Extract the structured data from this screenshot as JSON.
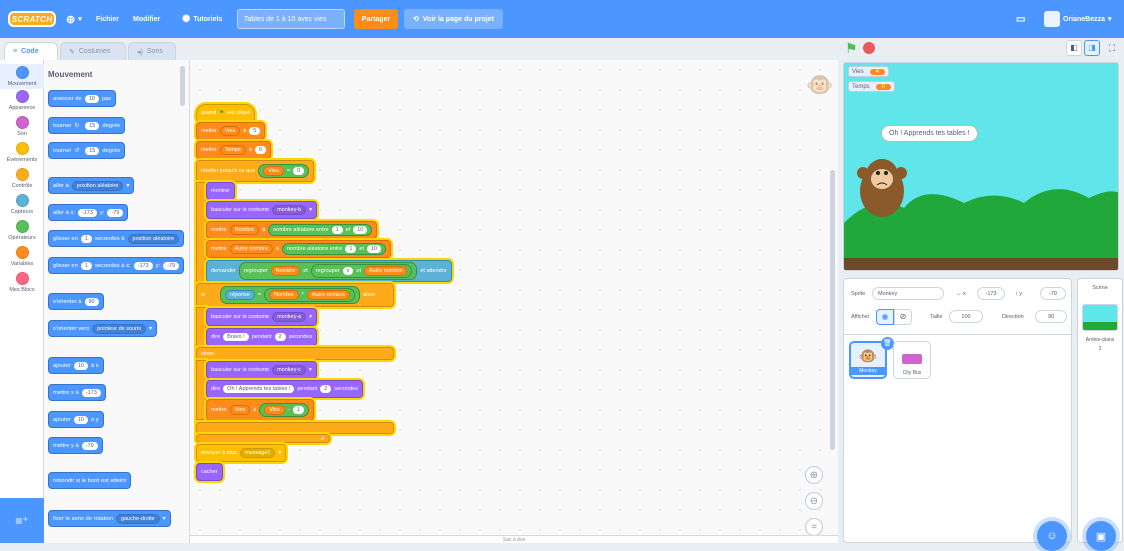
{
  "menubar": {
    "logo": "SCRATCH",
    "file": "Fichier",
    "edit": "Modifier",
    "tutorials": "Tutoriels",
    "project_title": "Tables de 1 à 10 avec vies",
    "share": "Partager",
    "project_page": "Voir la page du projet",
    "username": "OrianeBezza"
  },
  "tabs": {
    "code": "Code",
    "costumes": "Costumes",
    "sounds": "Sons"
  },
  "categories": [
    {
      "label": "Mouvement",
      "color": "#4c97ff"
    },
    {
      "label": "Apparence",
      "color": "#9966ff"
    },
    {
      "label": "Son",
      "color": "#cf63cf"
    },
    {
      "label": "Événements",
      "color": "#ffbf00"
    },
    {
      "label": "Contrôle",
      "color": "#ffab19"
    },
    {
      "label": "Capteurs",
      "color": "#5cb1d6"
    },
    {
      "label": "Opérateurs",
      "color": "#59c059"
    },
    {
      "label": "Variables",
      "color": "#ff8c1a"
    },
    {
      "label": "Mes Blocs",
      "color": "#ff6680"
    }
  ],
  "palette": {
    "heading": "Mouvement",
    "move": {
      "pre": "avancer de",
      "val": "10",
      "post": "pas"
    },
    "turn_right": {
      "pre": "tourner",
      "val": "15",
      "post": "degrés"
    },
    "turn_left": {
      "pre": "tourner",
      "val": "15",
      "post": "degrés"
    },
    "goto": {
      "pre": "aller à",
      "dd": "position aléatoire"
    },
    "gotoxy": {
      "pre": "aller à x:",
      "x": "-173",
      "mid": "y:",
      "y": "-79"
    },
    "glide1": {
      "pre": "glisser en",
      "val": "1",
      "mid": "secondes à",
      "dd": "position aléatoire"
    },
    "glide2": {
      "pre": "glisser en",
      "val": "1",
      "mid": "secondes à x:",
      "x": "-173",
      "ylab": "y:",
      "y": "-79"
    },
    "point": {
      "pre": "s'orienter à",
      "val": "90"
    },
    "pointto": {
      "pre": "s'orienter vers",
      "dd": "pointeur de souris"
    },
    "changex": {
      "pre": "ajouter",
      "val": "10",
      "post": "à x"
    },
    "setx": {
      "pre": "mettre x à",
      "val": "-173"
    },
    "changey": {
      "pre": "ajouter",
      "val": "10",
      "post": "à y"
    },
    "sety": {
      "pre": "mettre y à",
      "val": "-79"
    },
    "bounce": "rebondir si le bord est atteint",
    "rotation": {
      "pre": "fixer le sens de rotation",
      "dd": "gauche-droite"
    }
  },
  "script": {
    "hat": "quand",
    "hat_post": "est cliqué",
    "set_lives": {
      "pre": "mettre",
      "var": "Vies",
      "mid": "à",
      "val": "5"
    },
    "set_time": {
      "pre": "mettre",
      "var": "Temps",
      "mid": "à",
      "val": "0"
    },
    "repeat_until": {
      "pre": "répéter jusqu'à ce que",
      "var": "Vies",
      "op": "=",
      "val": "0"
    },
    "show": "montrer",
    "costume_b": {
      "pre": "basculer sur le costume",
      "dd": "monkey-b"
    },
    "set_num": {
      "pre": "mettre",
      "var": "Nombre",
      "mid": "à",
      "op": "nombre aléatoire entre",
      "a": "1",
      "and": "et",
      "b": "10"
    },
    "set_other": {
      "pre": "mettre",
      "var": "Autre nombre",
      "mid": "à",
      "op": "nombre aléatoire entre",
      "a": "1",
      "and": "et",
      "b": "10"
    },
    "ask": {
      "pre": "demander",
      "j1": "regrouper",
      "v1": "Nombre",
      "et": "et",
      "j2": "regrouper",
      "x": "x",
      "et2": "et",
      "v2": "Autre nombre",
      "post": "et attendre"
    },
    "if": {
      "pre": "si",
      "ans": "réponse",
      "eq": "=",
      "v1": "Nombre",
      "mul": "*",
      "v2": "Autre nombre",
      "post": "alors"
    },
    "costume_a": {
      "pre": "basculer sur le costume",
      "dd": "monkey-a"
    },
    "say_bravo": {
      "pre": "dire",
      "msg": "Bravo !",
      "mid": "pendant",
      "val": "2",
      "post": "secondes"
    },
    "else": "sinon",
    "costume_c": {
      "pre": "basculer sur le costume",
      "dd": "monkey-c"
    },
    "say_learn": {
      "pre": "dire",
      "msg": "Oh ! Apprends tes tables !",
      "mid": "pendant",
      "val": "2",
      "post": "secondes"
    },
    "dec_lives": {
      "pre": "mettre",
      "var": "Vies",
      "mid": "à",
      "v": "Vies",
      "op": "-",
      "val": "1"
    },
    "broadcast": {
      "pre": "envoyer à tous",
      "dd": "message1"
    },
    "hide": "cacher"
  },
  "backpack": "Sac à dos",
  "stage": {
    "monitors": [
      {
        "label": "Vies",
        "value": "4"
      },
      {
        "label": "Temps",
        "value": "0"
      }
    ],
    "speech": "Oh ! Apprends tes tables !"
  },
  "sprite_info": {
    "sprite_label": "Sprite",
    "sprite_name": "Monkey",
    "x_label": "x",
    "x": "-173",
    "y_label": "y",
    "y": "-79",
    "show_label": "Afficher",
    "size_label": "Taille",
    "size": "100",
    "direction_label": "Direction",
    "direction": "90"
  },
  "sprites": [
    {
      "name": "Monkey"
    },
    {
      "name": "City Bus"
    }
  ],
  "stage_pane": {
    "title": "Scène",
    "backdrops_label": "Arrière-plans",
    "backdrops_count": "3"
  }
}
